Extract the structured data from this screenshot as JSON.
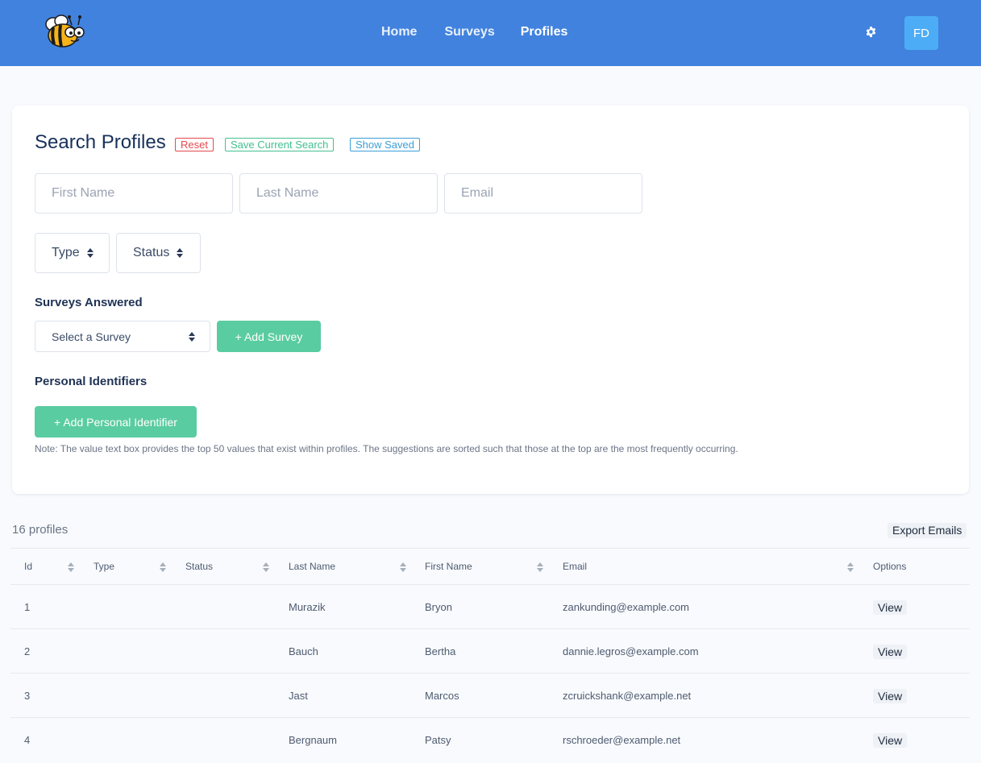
{
  "header": {
    "nav": [
      {
        "label": "Home"
      },
      {
        "label": "Surveys"
      },
      {
        "label": "Profiles"
      }
    ],
    "avatar_initials": "FD"
  },
  "search": {
    "title": "Search Profiles",
    "reset_label": "Reset",
    "save_label": "Save Current Search",
    "show_saved_label": "Show Saved",
    "first_name_placeholder": "First Name",
    "last_name_placeholder": "Last Name",
    "email_placeholder": "Email",
    "type_label": "Type",
    "status_label": "Status",
    "surveys_answered_label": "Surveys Answered",
    "survey_select_label": "Select a Survey",
    "add_survey_label": "+ Add Survey",
    "personal_identifiers_label": "Personal Identifiers",
    "add_identifier_label": "+ Add Personal Identifier",
    "note": "Note: The value text box provides the top 50 values that exist within profiles. The suggestions are sorted such that those at the top are the most frequently occurring."
  },
  "results": {
    "count_text": "16 profiles",
    "export_label": "Export Emails",
    "columns": [
      "Id",
      "Type",
      "Status",
      "Last Name",
      "First Name",
      "Email",
      "Options"
    ],
    "rows": [
      {
        "id": "1",
        "type": "",
        "status": "",
        "last_name": "Murazik",
        "first_name": "Bryon",
        "email": "zankunding@example.com",
        "action": "View"
      },
      {
        "id": "2",
        "type": "",
        "status": "",
        "last_name": "Bauch",
        "first_name": "Bertha",
        "email": "dannie.legros@example.com",
        "action": "View"
      },
      {
        "id": "3",
        "type": "",
        "status": "",
        "last_name": "Jast",
        "first_name": "Marcos",
        "email": "zcruickshank@example.net",
        "action": "View"
      },
      {
        "id": "4",
        "type": "",
        "status": "",
        "last_name": "Bergnaum",
        "first_name": "Patsy",
        "email": "rschroeder@example.net",
        "action": "View"
      }
    ]
  },
  "colors": {
    "header_bg": "#4182de",
    "avatar_bg": "#4dacf6",
    "green_button": "#5acca1",
    "reset_red": "#e5484d",
    "save_green": "#43c08f",
    "show_blue": "#3d9fd6"
  },
  "icons": {
    "logo": "bee-logo-icon",
    "settings": "gear-icon",
    "sort": "sort-updown-icon"
  }
}
